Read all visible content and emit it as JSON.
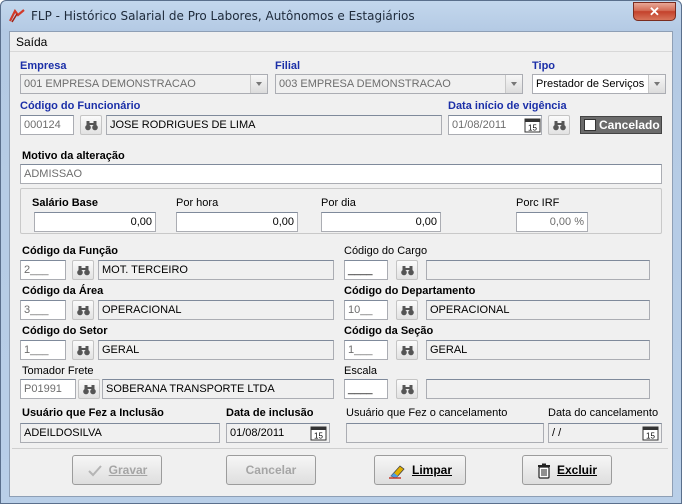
{
  "window": {
    "title": "FLP - Histórico Salarial de Pro Labores, Autônomos e Estagiários",
    "close_glyph": "✕"
  },
  "menu": {
    "items": [
      {
        "label": "Saída"
      }
    ]
  },
  "empresa": {
    "label": "Empresa",
    "value": "001 EMPRESA DEMONSTRACAO"
  },
  "filial": {
    "label": "Filial",
    "value": "003 EMPRESA DEMONSTRACAO"
  },
  "tipo": {
    "label": "Tipo",
    "value": "Prestador de Serviços"
  },
  "funcionario": {
    "label": "Código do Funcionário",
    "code": "000124",
    "name": "JOSE RODRIGUES  DE LIMA"
  },
  "vigencia": {
    "label": "Data início de vigência",
    "value": "01/08/2011",
    "calendar_day": "15"
  },
  "cancelado": {
    "label": "Cancelado",
    "checked": false
  },
  "motivo": {
    "label": "Motivo da alteração",
    "value": "ADMISSAO"
  },
  "salario": {
    "base_label": "Salário Base",
    "base_value": "0,00",
    "hora_label": "Por hora",
    "hora_value": "0,00",
    "dia_label": "Por dia",
    "dia_value": "0,00",
    "irf_label": "Porc IRF",
    "irf_value": "0,00 %"
  },
  "funcao": {
    "label": "Código da Função",
    "code": "2___",
    "name": "MOT. TERCEIRO"
  },
  "cargo": {
    "label": "Código do Cargo",
    "code": "____",
    "name": ""
  },
  "area": {
    "label": "Código da Área",
    "code": "3___",
    "name": "OPERACIONAL"
  },
  "departamento": {
    "label": "Código do Departamento",
    "code": "10__",
    "name": "OPERACIONAL"
  },
  "setor": {
    "label": "Código do Setor",
    "code": "1___",
    "name": "GERAL"
  },
  "secao": {
    "label": "Código da Seção",
    "code": "1___",
    "name": "GERAL"
  },
  "tomador": {
    "label": "Tomador Frete",
    "code": "P01991",
    "name": "SOBERANA TRANSPORTE LTDA"
  },
  "escala": {
    "label": "Escala",
    "code": "____",
    "name": ""
  },
  "inclusao": {
    "user_label": "Usuário que Fez a Inclusão",
    "user_value": "ADEILDOSILVA",
    "date_label": "Data de inclusão",
    "date_value": "01/08/2011"
  },
  "cancelamento": {
    "user_label": "Usuário que Fez o cancelamento",
    "user_value": "",
    "date_label": "Data do cancelamento",
    "date_value": " / /"
  },
  "buttons": {
    "gravar": "Gravar",
    "cancelar": "Cancelar",
    "limpar": "Limpar",
    "excluir": "Excluir"
  }
}
